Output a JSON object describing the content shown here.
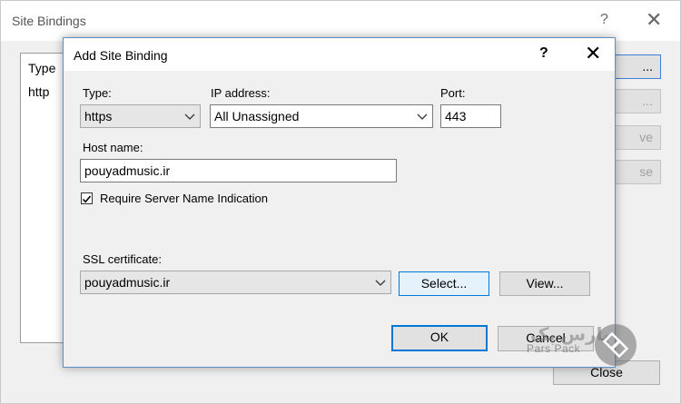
{
  "background_window": {
    "title": "Site Bindings",
    "help_icon": "?",
    "close_icon": "✕",
    "list": {
      "header": "Type",
      "rows": [
        "http"
      ]
    },
    "buttons": [
      "...",
      "...",
      "ve",
      "se"
    ],
    "close_label": "Close"
  },
  "dialog": {
    "title": "Add Site Binding",
    "help_icon": "?",
    "close_icon": "✕",
    "type": {
      "label": "Type:",
      "value": "https"
    },
    "ip_address": {
      "label": "IP address:",
      "value": "All Unassigned"
    },
    "port": {
      "label": "Port:",
      "value": "443"
    },
    "host_name": {
      "label": "Host name:",
      "value": "pouyadmusic.ir"
    },
    "sni": {
      "label": "Require Server Name Indication",
      "checked": true
    },
    "ssl_certificate": {
      "label": "SSL certificate:",
      "value": "pouyadmusic.ir"
    },
    "select_button": "Select...",
    "view_button": "View...",
    "ok_button": "OK",
    "cancel_button": "Cancel"
  },
  "watermark": {
    "script_text": "پارس پک",
    "latin_text": "Pars Pack"
  },
  "colors": {
    "dialog_background": "#f0f0f0",
    "focus_border": "#0078d7",
    "window_border": "#5d8fc7"
  }
}
